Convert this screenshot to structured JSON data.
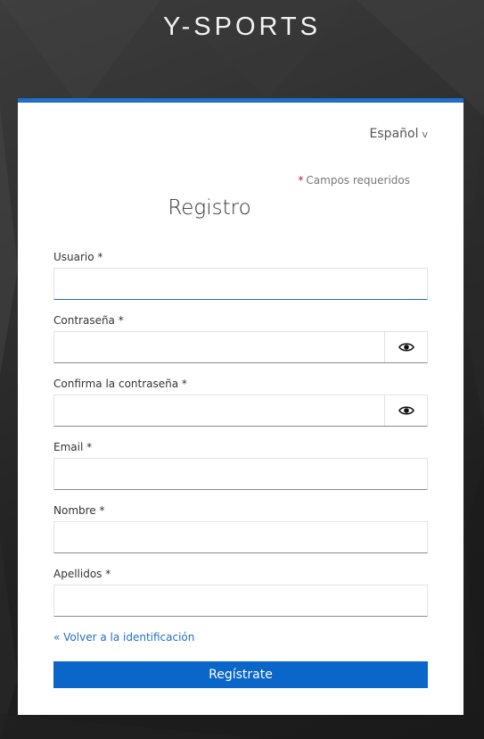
{
  "brand": {
    "title": "Y-SPORTS"
  },
  "language": {
    "selected": "Español",
    "chevron": "v"
  },
  "required_note": {
    "star": "*",
    "text": "Campos requeridos"
  },
  "form": {
    "title": "Registro",
    "fields": [
      {
        "label": "Usuario *",
        "value": "",
        "has_toggle": false
      },
      {
        "label": "Contraseña *",
        "value": "",
        "has_toggle": true
      },
      {
        "label": "Confirma la contraseña *",
        "value": "",
        "has_toggle": true
      },
      {
        "label": "Email *",
        "value": "",
        "has_toggle": false
      },
      {
        "label": "Nombre *",
        "value": "",
        "has_toggle": false
      },
      {
        "label": "Apellidos *",
        "value": "",
        "has_toggle": false
      }
    ],
    "back_link": "« Volver a la identificación",
    "submit_label": "Regístrate"
  },
  "colors": {
    "accent": "#1f6fc9",
    "button": "#0a66c9",
    "required_star": "#b3202e"
  }
}
